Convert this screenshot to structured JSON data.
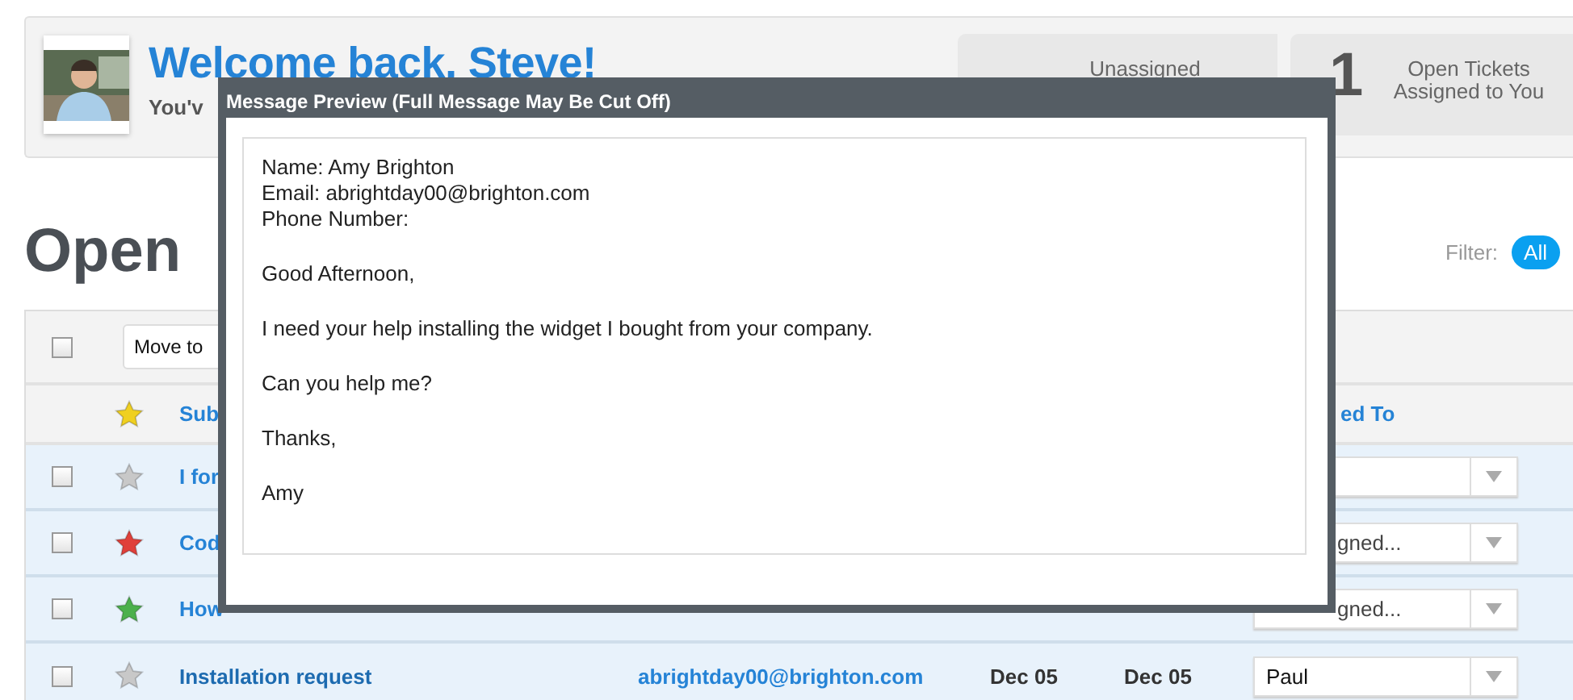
{
  "header": {
    "welcome": "Welcome back, Steve!",
    "subtitle": "You'v",
    "stats": [
      {
        "label": "Unassigned"
      },
      {
        "count": "1",
        "label": "Open Tickets Assigned to You"
      }
    ]
  },
  "page_title": "Open",
  "filter": {
    "label": "Filter:",
    "options": [
      {
        "label": "All",
        "selected": true
      }
    ]
  },
  "toolbar": {
    "select_all_checked": false,
    "move_select": "Move to"
  },
  "table": {
    "header": {
      "starred": true,
      "subject": "Sub",
      "assigned": "ed To"
    },
    "rows": [
      {
        "kind": "covered",
        "checked": false,
        "color": "#c8c8c8",
        "subject": "I for",
        "assigned": ""
      },
      {
        "kind": "covered",
        "checked": false,
        "color": "#e0403a",
        "subject": "Cod",
        "assigned": "gned..."
      },
      {
        "kind": "covered",
        "checked": false,
        "color": "#4cb04c",
        "subject": "How",
        "assigned": "gned..."
      },
      {
        "kind": "full",
        "checked": false,
        "color": "#c8c8c8",
        "subject": "Installation request",
        "email": "abrightday00@brighton.com",
        "created": "Dec 05",
        "updated": "Dec 05",
        "assigned": "Paul"
      }
    ]
  },
  "modal": {
    "title": "Message Preview (Full Message May Be Cut Off)",
    "header_lines": [
      "Name: Amy Brighton",
      "Email: abrightday00@brighton.com",
      "Phone Number:"
    ],
    "paragraphs": [
      "Good Afternoon,",
      "I need your help installing the widget I bought from your company.",
      "Can you help me?",
      "Thanks,",
      "Amy"
    ]
  }
}
